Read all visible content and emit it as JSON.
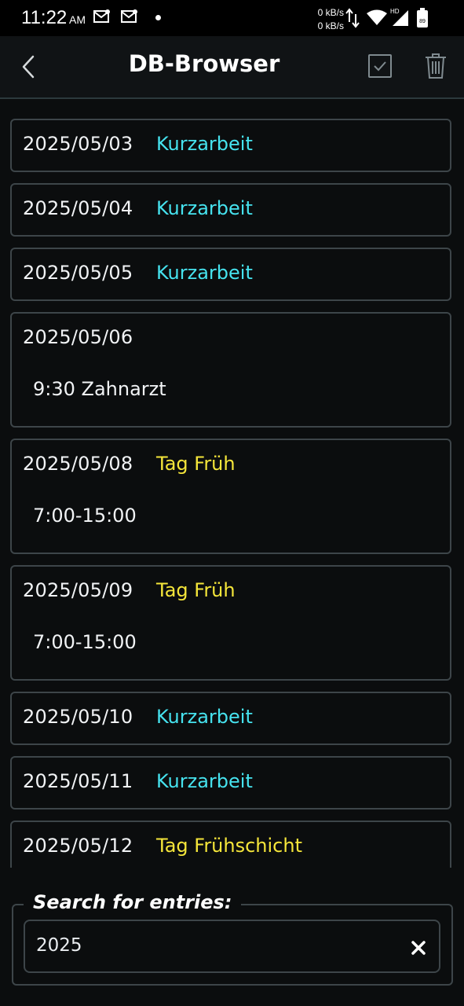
{
  "status_bar": {
    "time": "11:22",
    "ampm": "AM",
    "net_up": "0 kB/s",
    "net_down": "0 kB/s",
    "battery_level": "89",
    "signal_label": "HD"
  },
  "toolbar": {
    "title": "DB-Browser",
    "back_icon": "chevron-left-icon",
    "check_icon": "checkbox-icon",
    "trash_icon": "trash-icon"
  },
  "entries": [
    {
      "date": "2025/05/03",
      "tag": "Kurzarbeit",
      "tag_color": "#46e3ef"
    },
    {
      "date": "2025/05/04",
      "tag": "Kurzarbeit",
      "tag_color": "#46e3ef"
    },
    {
      "date": "2025/05/05",
      "tag": "Kurzarbeit",
      "tag_color": "#46e3ef"
    },
    {
      "date": "2025/05/06",
      "tag": "",
      "note": "9:30 Zahnarzt"
    },
    {
      "date": "2025/05/08",
      "tag": "Tag Früh",
      "tag_color": "#f5e63a",
      "note": "7:00-15:00"
    },
    {
      "date": "2025/05/09",
      "tag": "Tag Früh",
      "tag_color": "#f5e63a",
      "note": "7:00-15:00"
    },
    {
      "date": "2025/05/10",
      "tag": "Kurzarbeit",
      "tag_color": "#46e3ef"
    },
    {
      "date": "2025/05/11",
      "tag": "Kurzarbeit",
      "tag_color": "#46e3ef"
    },
    {
      "date": "2025/05/12",
      "tag": "Tag Frühschicht",
      "tag_color": "#f5e63a"
    }
  ],
  "search": {
    "label": "Search for entries:",
    "value": "2025",
    "clear_icon": "close-icon"
  }
}
